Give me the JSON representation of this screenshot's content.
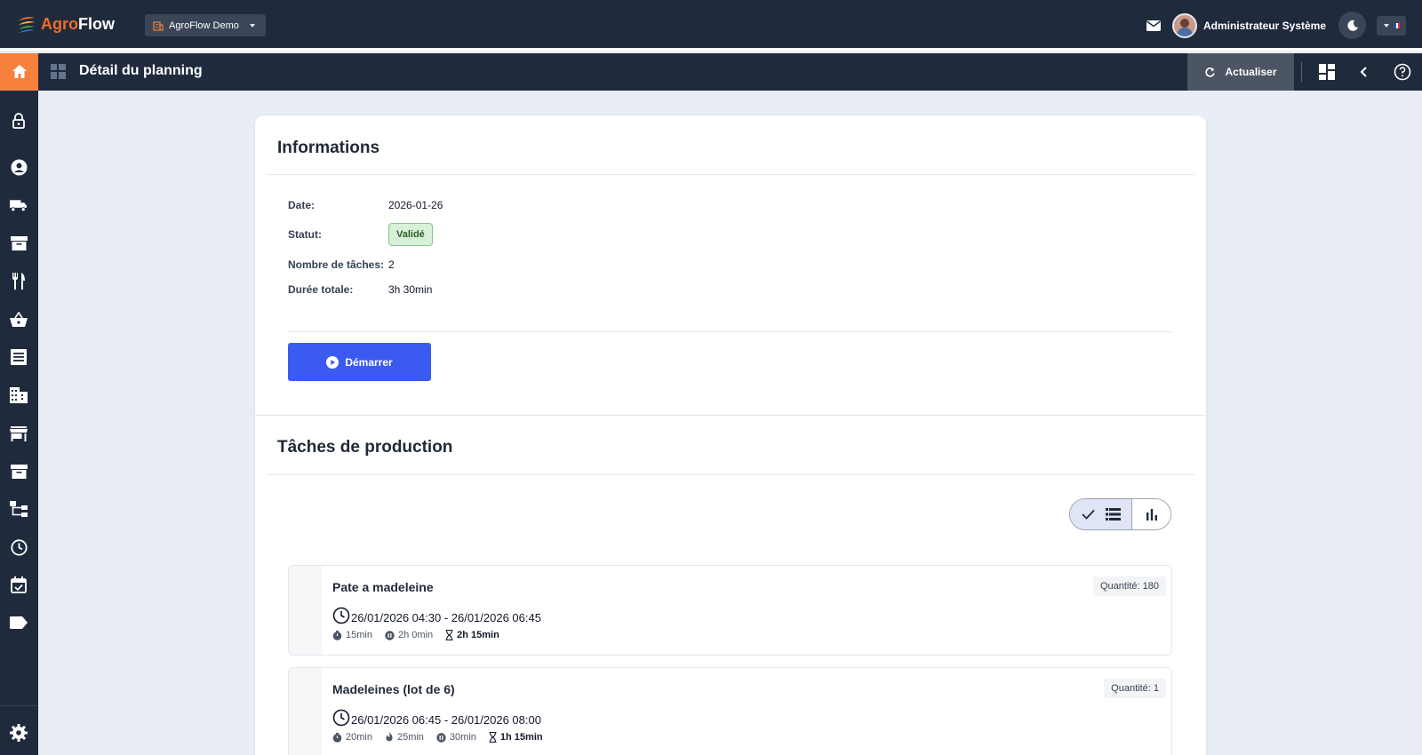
{
  "app": {
    "logo_part1": "Agro",
    "logo_part2": "Flow",
    "org_select": "AgroFlow Demo",
    "user_name": "Administrateur Système"
  },
  "subbar": {
    "page_title": "Détail du planning",
    "refresh_label": "Actualiser"
  },
  "info": {
    "title": "Informations",
    "rows": [
      {
        "label": "Date:",
        "value": "2026-01-26"
      },
      {
        "label": "Statut:",
        "value": "Validé"
      },
      {
        "label": "Nombre de tâches:",
        "value": "2"
      },
      {
        "label": "Durée totale:",
        "value": "3h 30min"
      }
    ],
    "start_label": "Démarrer"
  },
  "tasks": {
    "title": "Tâches de production",
    "items": [
      {
        "name": "Pate a madeleine",
        "quantity": "Quantité: 180",
        "time": "26/01/2026 04:30 - 26/01/2026 06:45",
        "meta": [
          {
            "icon": "timer-icon",
            "text": "15min"
          },
          {
            "icon": "pause-circle-icon",
            "text": "2h 0min"
          },
          {
            "icon": "hourglass-icon",
            "text": "2h 15min",
            "bold": true
          }
        ]
      },
      {
        "name": "Madeleines (lot de 6)",
        "quantity": "Quantité: 1",
        "time": "26/01/2026 06:45 - 26/01/2026 08:00",
        "meta": [
          {
            "icon": "timer-icon",
            "text": "20min"
          },
          {
            "icon": "flame-icon",
            "text": "25min"
          },
          {
            "icon": "pause-circle-icon",
            "text": "30min"
          },
          {
            "icon": "hourglass-icon",
            "text": "1h 15min",
            "bold": true
          }
        ]
      }
    ]
  },
  "colors": {
    "topbar": "#1f2b3d",
    "accent": "#f5813d",
    "primary_button": "#3b5bf0",
    "status_badge": "#d8f0d8"
  }
}
